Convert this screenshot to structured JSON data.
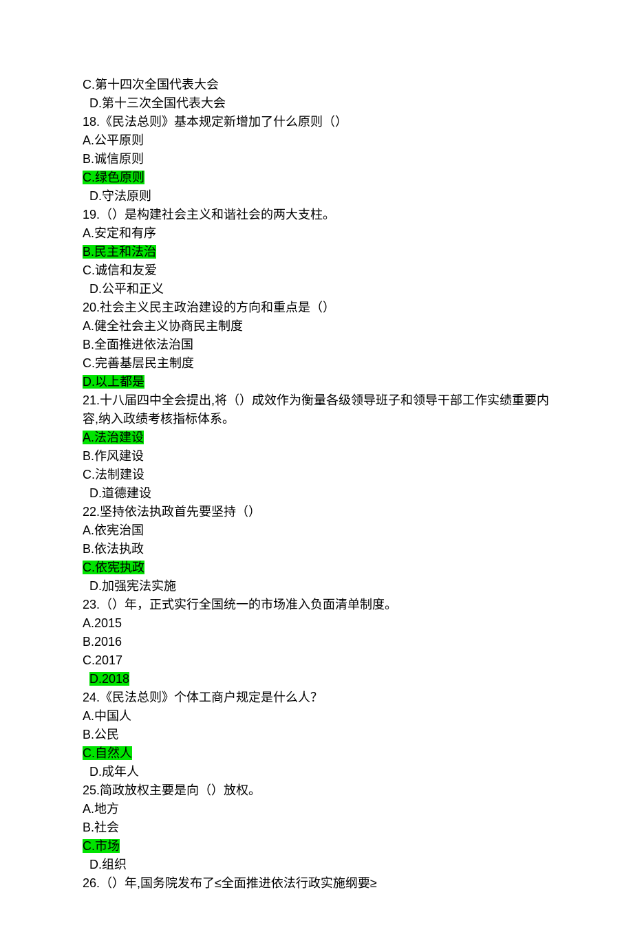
{
  "lines": [
    {
      "text": "C.第十四次全国代表大会",
      "highlighted": false,
      "indent": false
    },
    {
      "text": "D.第十三次全国代表大会",
      "highlighted": false,
      "indent": true
    },
    {
      "text": "18.《民法总则》基本规定新增加了什么原则（）",
      "highlighted": false,
      "indent": false
    },
    {
      "text": "A.公平原则",
      "highlighted": false,
      "indent": false
    },
    {
      "text": "B.诚信原则",
      "highlighted": false,
      "indent": false
    },
    {
      "text": "C.绿色原则",
      "highlighted": true,
      "indent": false
    },
    {
      "text": "D.守法原则",
      "highlighted": false,
      "indent": true
    },
    {
      "text": "19.（）是构建社会主义和谐社会的两大支柱。",
      "highlighted": false,
      "indent": false
    },
    {
      "text": "A.安定和有序",
      "highlighted": false,
      "indent": false
    },
    {
      "text": "B.民主和法治",
      "highlighted": true,
      "indent": false
    },
    {
      "text": "C.诚信和友爱",
      "highlighted": false,
      "indent": false
    },
    {
      "text": "D.公平和正义",
      "highlighted": false,
      "indent": true
    },
    {
      "text": "20.社会主义民主政治建设的方向和重点是（）",
      "highlighted": false,
      "indent": false
    },
    {
      "text": "A.健全社会主义协商民主制度",
      "highlighted": false,
      "indent": false
    },
    {
      "text": "B.全面推进依法治国",
      "highlighted": false,
      "indent": false
    },
    {
      "text": "C.完善基层民主制度",
      "highlighted": false,
      "indent": false
    },
    {
      "text": "D.以上都是",
      "highlighted": true,
      "indent": false
    },
    {
      "text": "21.十八届四中全会提出,将（）成效作为衡量各级领导班子和领导干部工作实绩重要内容,纳入政绩考核指标体系。",
      "highlighted": false,
      "indent": false
    },
    {
      "text": "A.法治建设",
      "highlighted": true,
      "indent": false
    },
    {
      "text": "B.作风建设",
      "highlighted": false,
      "indent": false
    },
    {
      "text": "C.法制建设",
      "highlighted": false,
      "indent": false
    },
    {
      "text": "D.道德建设",
      "highlighted": false,
      "indent": true
    },
    {
      "text": "22.坚持依法执政首先要坚持（）",
      "highlighted": false,
      "indent": false
    },
    {
      "text": "A.依宪治国",
      "highlighted": false,
      "indent": false
    },
    {
      "text": "B.依法执政",
      "highlighted": false,
      "indent": false
    },
    {
      "text": "C.依宪执政",
      "highlighted": true,
      "indent": false
    },
    {
      "text": "D.加强宪法实施",
      "highlighted": false,
      "indent": true
    },
    {
      "text": "23.（）年，正式实行全国统一的市场准入负面清单制度。",
      "highlighted": false,
      "indent": false
    },
    {
      "text": "A.2015",
      "highlighted": false,
      "indent": false
    },
    {
      "text": "B.2016",
      "highlighted": false,
      "indent": false
    },
    {
      "text": "C.2017",
      "highlighted": false,
      "indent": false
    },
    {
      "text": "D.2018",
      "highlighted": true,
      "indent": true
    },
    {
      "text": "24.《民法总则》个体工商户规定是什么人？",
      "highlighted": false,
      "indent": false
    },
    {
      "text": "A.中国人",
      "highlighted": false,
      "indent": false
    },
    {
      "text": "B.公民",
      "highlighted": false,
      "indent": false
    },
    {
      "text": "C.自然人",
      "highlighted": true,
      "indent": false
    },
    {
      "text": "D.成年人",
      "highlighted": false,
      "indent": true
    },
    {
      "text": "25.简政放权主要是向（）放权。",
      "highlighted": false,
      "indent": false
    },
    {
      "text": "A.地方",
      "highlighted": false,
      "indent": false
    },
    {
      "text": "B.社会",
      "highlighted": false,
      "indent": false
    },
    {
      "text": "C.市场",
      "highlighted": true,
      "indent": false
    },
    {
      "text": "D.组织",
      "highlighted": false,
      "indent": true
    },
    {
      "text": "26.（）年,国务院发布了≤全面推进依法行政实施纲要≥",
      "highlighted": false,
      "indent": false
    }
  ]
}
